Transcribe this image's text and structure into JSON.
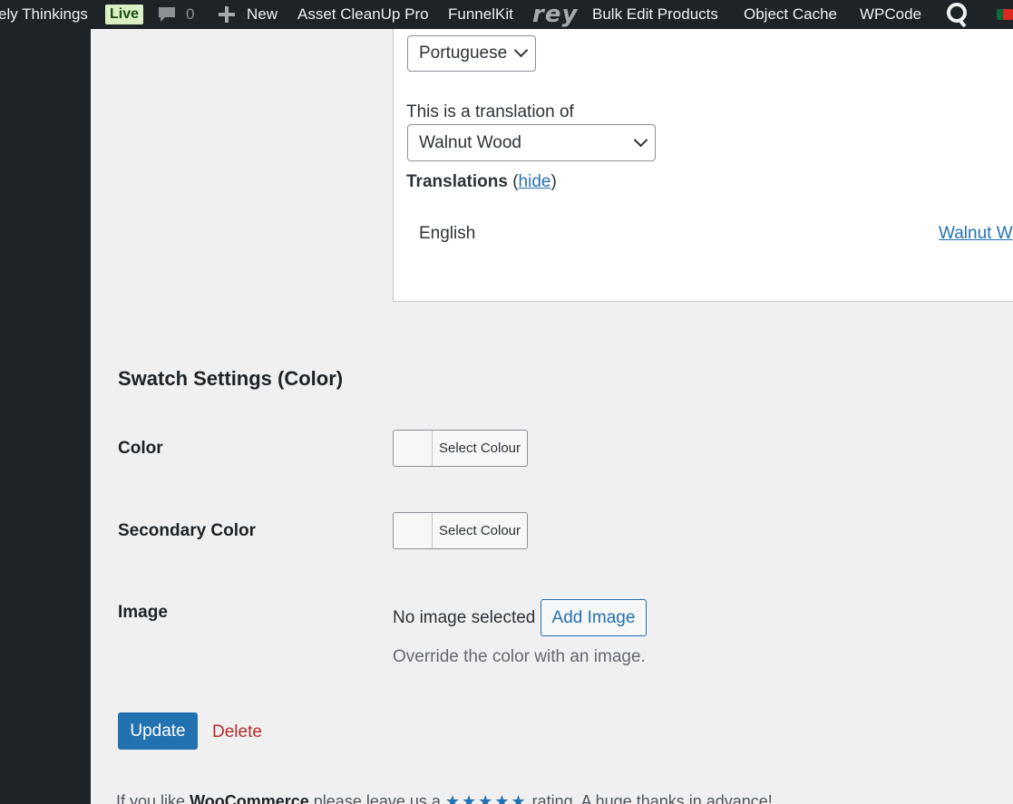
{
  "admin_bar": {
    "site_name": "ely Thinkings",
    "live_badge": "Live",
    "comments_count": "0",
    "new_label": "New",
    "items": [
      "Asset CleanUp Pro",
      "FunnelKit",
      "rey",
      "Bulk Edit Products",
      "Object Cache",
      "WPCode"
    ],
    "icons": [
      "comment-bubble-icon",
      "plus-icon",
      "rey-logo",
      "quick-search-icon",
      "portugal-flag-icon"
    ]
  },
  "translation": {
    "language_select_value": "Portuguese",
    "translation_of_label": "This is a translation of",
    "translation_of_value": "Walnut Wood",
    "translations_heading": "Translations",
    "hide_link": "hide",
    "rows": [
      {
        "language": "English",
        "link": "Walnut W"
      }
    ]
  },
  "swatch": {
    "heading": "Swatch Settings (Color)",
    "color_label": "Color",
    "secondary_color_label": "Secondary Color",
    "select_colour": "Select Colour",
    "image_label": "Image",
    "no_image": "No image selected",
    "add_image": "Add Image",
    "image_description": "Override the color with an image."
  },
  "actions": {
    "update": "Update",
    "delete": "Delete"
  },
  "footer": {
    "prefix": "If you like",
    "brand": "WooCommerce",
    "middle": "please leave us a",
    "stars": "★★★★★",
    "suffix": "rating. A huge thanks in advance!"
  },
  "colors": {
    "admin_bar_bg": "#1d2327",
    "accent": "#2271b1",
    "danger": "#b32d2e",
    "page_bg": "#f0f0f1"
  }
}
